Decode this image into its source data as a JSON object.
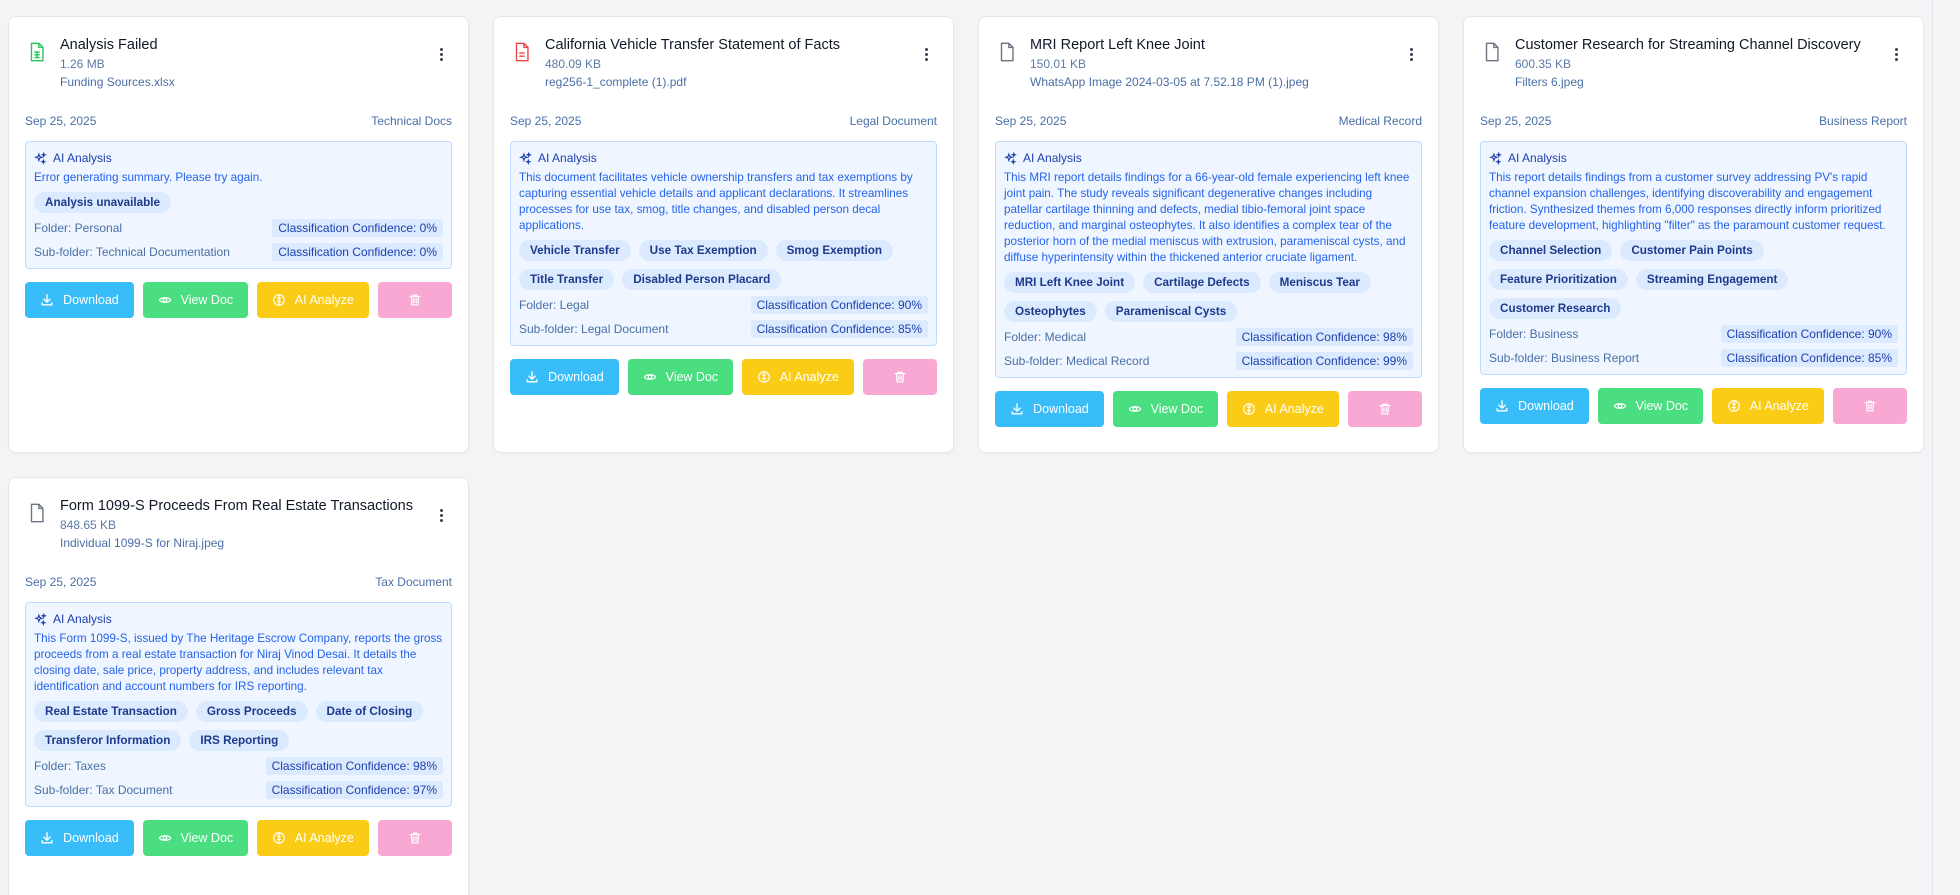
{
  "cards": [
    {
      "title": "Analysis Failed",
      "size": "1.26 MB",
      "filename": "Funding Sources.xlsx",
      "file_icon": "spreadsheet-file-icon",
      "file_icon_color": "#22c55e",
      "date": "Sep 25, 2025",
      "category": "Technical Docs",
      "ai_label": "AI Analysis",
      "summary": "Error generating summary. Please try again.",
      "tags": [
        "Analysis unavailable"
      ],
      "folder": "Folder: Personal",
      "folder_conf": "Classification Confidence: 0%",
      "subfolder": "Sub-folder: Technical Documentation",
      "subfolder_conf": "Classification Confidence: 0%"
    },
    {
      "title": "California Vehicle Transfer Statement of Facts",
      "size": "480.09 KB",
      "filename": "reg256-1_complete (1).pdf",
      "file_icon": "pdf-file-icon",
      "file_icon_color": "#ef4444",
      "date": "Sep 25, 2025",
      "category": "Legal Document",
      "ai_label": "AI Analysis",
      "summary": "This document facilitates vehicle ownership transfers and tax exemptions by capturing essential vehicle details and applicant declarations. It streamlines processes for use tax, smog, title changes, and disabled person decal applications.",
      "tags": [
        "Vehicle Transfer",
        "Use Tax Exemption",
        "Smog Exemption",
        "Title Transfer",
        "Disabled Person Placard"
      ],
      "folder": "Folder: Legal",
      "folder_conf": "Classification Confidence: 90%",
      "subfolder": "Sub-folder: Legal Document",
      "subfolder_conf": "Classification Confidence: 85%"
    },
    {
      "title": "MRI Report Left Knee Joint",
      "size": "150.01 KB",
      "filename": "WhatsApp Image 2024-03-05 at 7.52.18 PM (1).jpeg",
      "file_icon": "file-icon",
      "file_icon_color": "#6b7280",
      "date": "Sep 25, 2025",
      "category": "Medical Record",
      "ai_label": "AI Analysis",
      "summary": "This MRI report details findings for a 66-year-old female experiencing left knee joint pain. The study reveals significant degenerative changes including patellar cartilage thinning and defects, medial tibio-femoral joint space reduction, and marginal osteophytes. It also identifies a complex tear of the posterior horn of the medial meniscus with extrusion, parameniscal cysts, and diffuse hyperintensity within the thickened anterior cruciate ligament.",
      "tags": [
        "MRI Left Knee Joint",
        "Cartilage Defects",
        "Meniscus Tear",
        "Osteophytes",
        "Parameniscal Cysts"
      ],
      "folder": "Folder: Medical",
      "folder_conf": "Classification Confidence: 98%",
      "subfolder": "Sub-folder: Medical Record",
      "subfolder_conf": "Classification Confidence: 99%"
    },
    {
      "title": "Customer Research for Streaming Channel Discovery",
      "size": "600.35 KB",
      "filename": "Filters 6.jpeg",
      "file_icon": "file-icon",
      "file_icon_color": "#6b7280",
      "date": "Sep 25, 2025",
      "category": "Business Report",
      "ai_label": "AI Analysis",
      "summary": "This report details findings from a customer survey addressing PV's rapid channel expansion challenges, identifying discoverability and engagement friction. Synthesized themes from 6,000 responses directly inform prioritized feature development, highlighting \"filter\" as the paramount customer request.",
      "tags": [
        "Channel Selection",
        "Customer Pain Points",
        "Feature Prioritization",
        "Streaming Engagement",
        "Customer Research"
      ],
      "folder": "Folder: Business",
      "folder_conf": "Classification Confidence: 90%",
      "subfolder": "Sub-folder: Business Report",
      "subfolder_conf": "Classification Confidence: 85%"
    },
    {
      "title": "Form 1099-S Proceeds From Real Estate Transactions",
      "size": "848.65 KB",
      "filename": "Individual 1099-S for Niraj.jpeg",
      "file_icon": "file-icon",
      "file_icon_color": "#6b7280",
      "date": "Sep 25, 2025",
      "category": "Tax Document",
      "ai_label": "AI Analysis",
      "summary": "This Form 1099-S, issued by The Heritage Escrow Company, reports the gross proceeds from a real estate transaction for Niraj Vinod Desai. It details the closing date, sale price, property address, and includes relevant tax identification and account numbers for IRS reporting.",
      "tags": [
        "Real Estate Transaction",
        "Gross Proceeds",
        "Date of Closing",
        "Transferor Information",
        "IRS Reporting"
      ],
      "folder": "Folder: Taxes",
      "folder_conf": "Classification Confidence: 98%",
      "subfolder": "Sub-folder: Tax Document",
      "subfolder_conf": "Classification Confidence: 97%"
    }
  ],
  "buttons": {
    "download": "Download",
    "view": "View Doc",
    "analyze": "AI Analyze",
    "delete_icon": "trash-icon"
  },
  "colors": {
    "download": "#38bdf8",
    "view": "#4ade80",
    "analyze": "#facc15",
    "delete": "#f9a8d4",
    "ai_panel": "#eff6ff"
  }
}
